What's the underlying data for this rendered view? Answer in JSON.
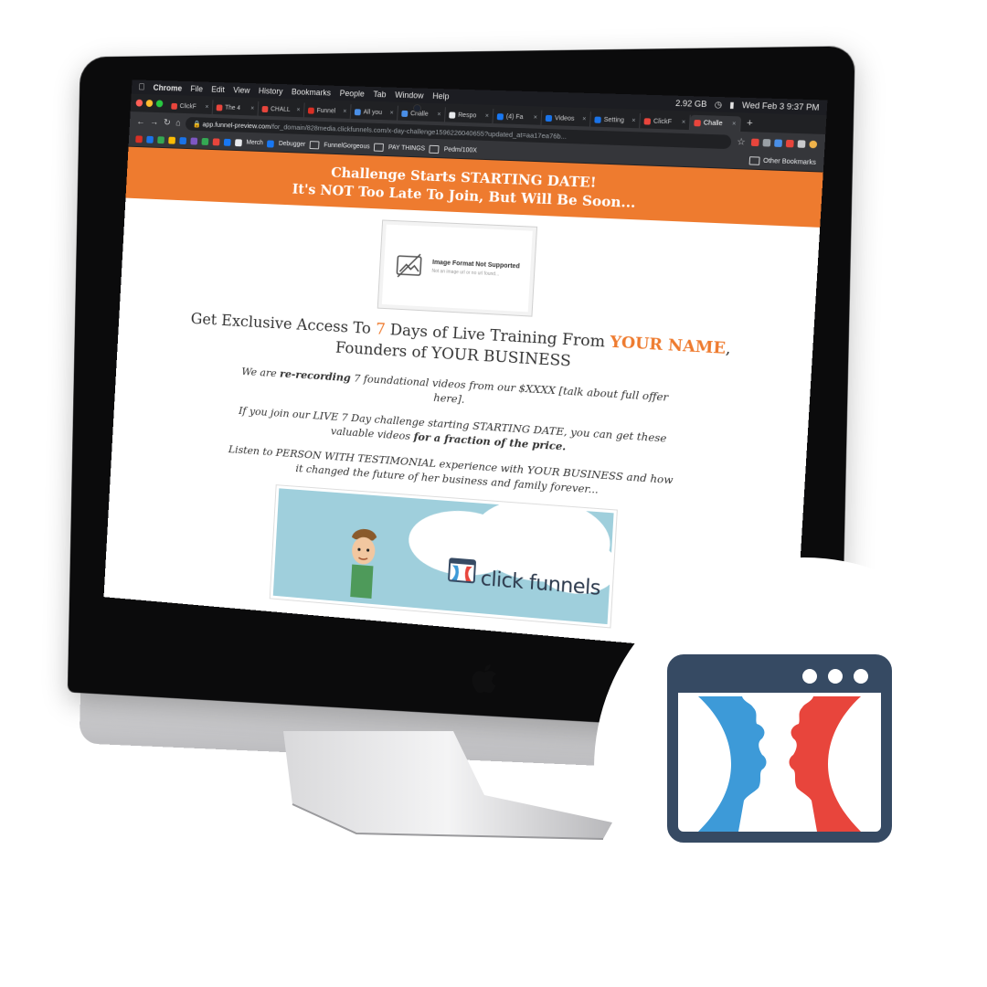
{
  "mac_menubar": {
    "app_name": "Chrome",
    "menus": [
      "File",
      "Edit",
      "View",
      "History",
      "Bookmarks",
      "People",
      "Tab",
      "Window",
      "Help"
    ],
    "memory": "2.92 GB",
    "datetime": "Wed Feb 3  9:37 PM"
  },
  "tabs": [
    {
      "label": "ClickF",
      "color": "#e8453c"
    },
    {
      "label": "The 4",
      "color": "#e8453c"
    },
    {
      "label": "CHALL",
      "color": "#e8453c"
    },
    {
      "label": "Funnel",
      "color": "#d93025"
    },
    {
      "label": "All you",
      "color": "#4a8fe7"
    },
    {
      "label": "Challe",
      "color": "#4a8fe7"
    },
    {
      "label": "Respo",
      "color": "#e8eaed"
    },
    {
      "label": "(4) Fa",
      "color": "#1877f2"
    },
    {
      "label": "Videos",
      "color": "#1a73e8"
    },
    {
      "label": "Setting",
      "color": "#1a73e8"
    },
    {
      "label": "ClickF",
      "color": "#e8453c"
    },
    {
      "label": "Challe",
      "color": "#e8453c",
      "active": true
    }
  ],
  "omnibox": {
    "host": "app.funnel-preview.com",
    "path": "/for_domain/828media.clickfunnels.com/x-day-challenge1596226040655?updated_at=aa17ea76b..."
  },
  "bookmarks": {
    "items": [
      "Merch",
      "Debugger",
      "FunnelGorgeous",
      "PAY THINGS",
      "Pedm/100X"
    ],
    "other": "Other Bookmarks"
  },
  "page": {
    "banner_line1": "Challenge Starts STARTING DATE!",
    "banner_line2": "It's NOT Too Late To Join, But Will Be Soon...",
    "placeholder_title": "Image Format Not Supported",
    "placeholder_sub": "Not an image url or no url found...",
    "headline_pre": "Get Exclusive Access To ",
    "headline_num": "7",
    "headline_mid": " Days of Live Training From ",
    "headline_name": "YOUR NAME",
    "headline_comma": ",",
    "headline_line2": "Founders of YOUR BUSINESS",
    "p1_pre": "We are ",
    "p1_bold": "re-recording",
    "p1_post": " 7 foundational videos from our $XXXX [talk about full offer here].",
    "p2_pre": "If you join our LIVE 7 Day challenge starting STARTING DATE, you can get these valuable videos ",
    "p2_bold": "for a fraction of the price.",
    "p3": "Listen to PERSON WITH TESTIMONIAL experience with YOUR BUSINESS and how it changed the future of her business and family forever...",
    "video_logo_text": "click funnels"
  },
  "colors": {
    "accent_orange": "#ee7b2f",
    "cf_blue": "#3d9ad8",
    "cf_red": "#e8453c",
    "cf_navy": "#364a63"
  }
}
